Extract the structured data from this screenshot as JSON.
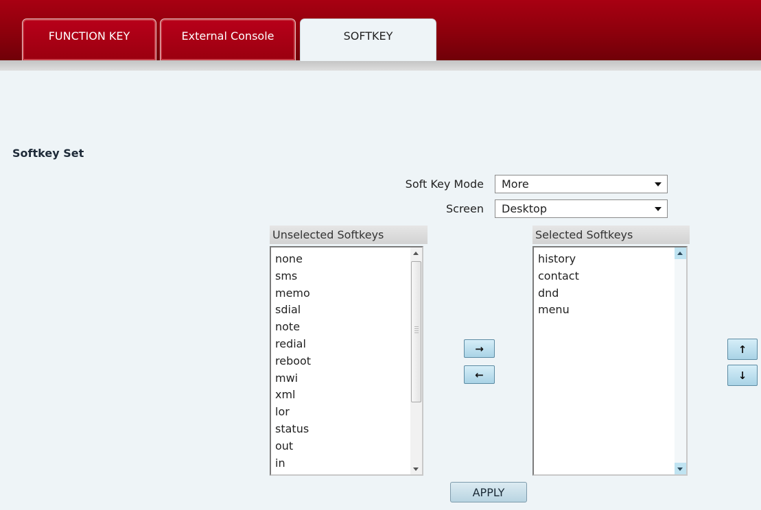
{
  "tabs": [
    {
      "label": "FUNCTION KEY",
      "active": false
    },
    {
      "label": "External Console",
      "active": false
    },
    {
      "label": "SOFTKEY",
      "active": true
    }
  ],
  "section": {
    "title": "Softkey Set"
  },
  "form": {
    "soft_key_mode": {
      "label": "Soft Key Mode",
      "value": "More"
    },
    "screen": {
      "label": "Screen",
      "value": "Desktop"
    }
  },
  "unselected": {
    "header": "Unselected Softkeys",
    "items": [
      "none",
      "sms",
      "memo",
      "sdial",
      "note",
      "redial",
      "reboot",
      "mwi",
      "xml",
      "lor",
      "status",
      "out",
      "in"
    ]
  },
  "selected": {
    "header": "Selected Softkeys",
    "items": [
      "history",
      "contact",
      "dnd",
      "menu"
    ]
  },
  "buttons": {
    "move_right": "→",
    "move_left": "←",
    "move_up": "↑",
    "move_down": "↓",
    "apply": "APPLY"
  },
  "colors": {
    "brand": "#9a000f",
    "page_bg": "#eef4f7",
    "button_accent": "#a9d3e6"
  }
}
